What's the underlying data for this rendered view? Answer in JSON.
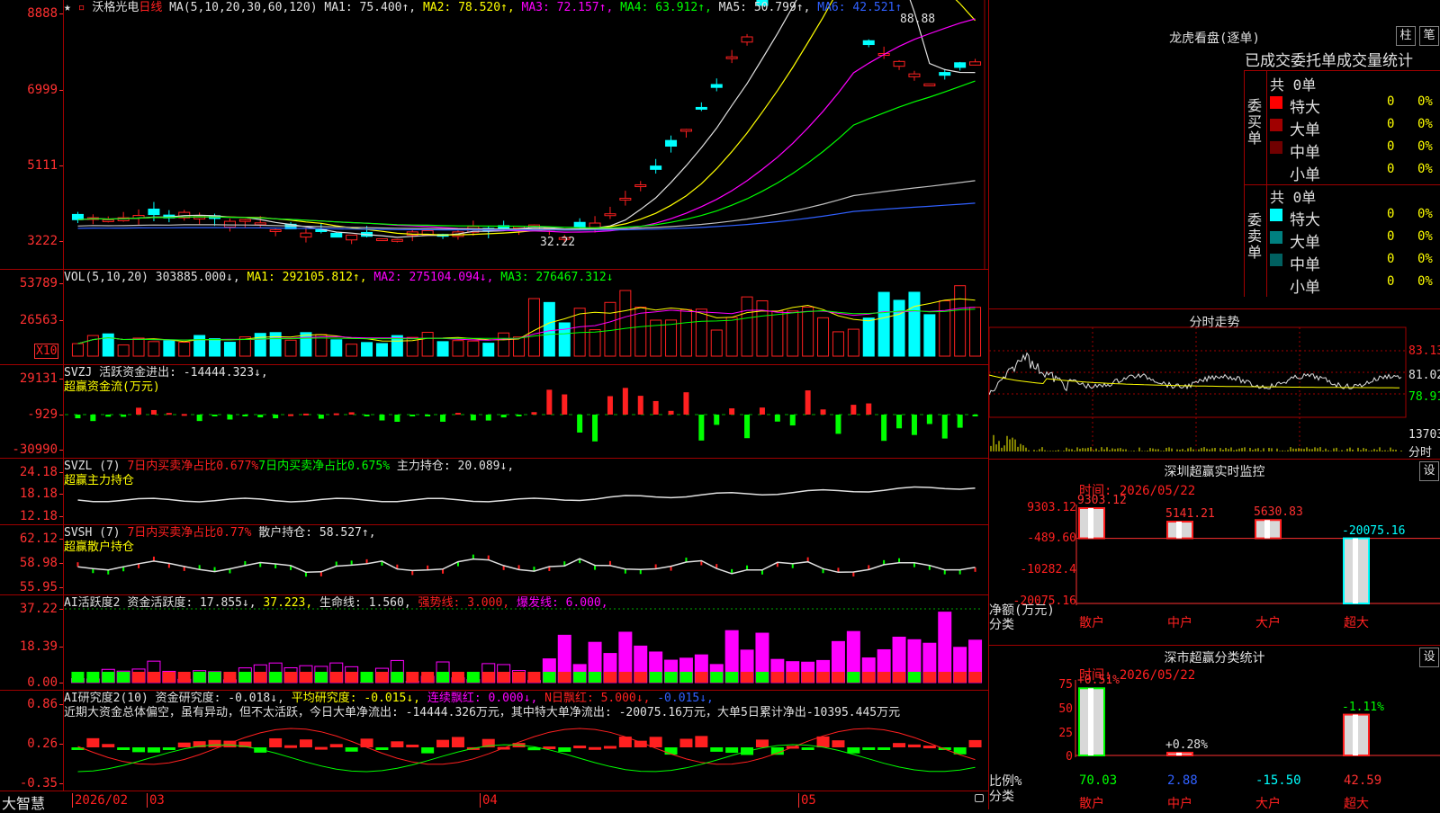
{
  "main": {
    "stock_name": "沃格光电",
    "period": "日线",
    "ma_params": "MA(5,10,20,30,60,120)",
    "ma_values": [
      {
        "label": "MA1: 75.400↑,",
        "color": "#e0e0e0"
      },
      {
        "label": "MA2: 78.520↑,",
        "color": "#ffff00"
      },
      {
        "label": "MA3: 72.157↑,",
        "color": "#ff00ff"
      },
      {
        "label": "MA4: 63.912↑,",
        "color": "#00ff00"
      },
      {
        "label": "MA5: 50.799↑,",
        "color": "#e0e0e0"
      },
      {
        "label": "MA6: 42.521↑",
        "color": "#3060ff"
      }
    ],
    "y_labels": [
      "8888",
      "6999",
      "5111",
      "3222"
    ],
    "high_marker": "88.88",
    "low_marker": "32.22"
  },
  "vol": {
    "header": "VOL(5,10,20)",
    "value": "303885.000↓,",
    "ma1": "MA1: 292105.812↑,",
    "ma2": "MA2: 275104.094↓,",
    "ma3": "MA3: 276467.312↓",
    "y_labels": [
      "53789",
      "26563"
    ],
    "unit_label": "X10"
  },
  "svzj": {
    "header": "SVZJ  活跃资金进出: -14444.323↓,",
    "subtitle": "超赢资金流(万元)",
    "y_labels": [
      "29131",
      "-929",
      "-30990"
    ]
  },
  "svzl": {
    "prefix": "SVZL (7)",
    "t1": "7日内买卖净占比0.677%",
    "t2": "7日内买卖净占比0.675%",
    "t3": "主力持仓: 20.089↓,",
    "subtitle": "超赢主力持仓",
    "y_labels": [
      "24.18",
      "18.18",
      "12.18"
    ]
  },
  "svsh": {
    "prefix": "SVSH (7)",
    "t1": "7日内买卖净占比0.77%",
    "t2": "散户持仓: 58.527↑,",
    "subtitle": "超赢散户持仓",
    "y_labels": [
      "62.12",
      "58.98",
      "55.95"
    ]
  },
  "ai1": {
    "prefix": "AI活跃度2",
    "t1": "资金活跃度: 17.855↓,",
    "t2": "37.223,",
    "t3": "生命线: 1.560,",
    "t4": "强势线: 3.000,",
    "t5": "爆发线: 6.000,",
    "y_labels": [
      "37.22",
      "18.39",
      "0.00"
    ]
  },
  "ai2": {
    "prefix": "AI研究度2(10)",
    "t1": "资金研究度: -0.018↓,",
    "t2": "平均研究度: -0.015↓,",
    "t3": "连续飘红: 0.000↓,",
    "t4": "N日飘红: 5.000↓,",
    "t5": "-0.015↓,",
    "comment": "近期大资金总体偏空，虽有异动，但不太活跃，今日大单净流出: -14444.326万元，其中特大单净流出: -20075.16万元，大单5日累计净出-10395.445万元",
    "y_labels": [
      "0.86",
      "0.26",
      "-0.35"
    ]
  },
  "xaxis": {
    "brand": "大智慧",
    "labels": [
      "2026/02",
      "03",
      "04",
      "05"
    ]
  },
  "dragon": {
    "title": "龙虎看盘(逐单)",
    "btn1": "柱",
    "btn2": "笔",
    "subtitle": "已成交委托单成交量统计",
    "buy_label": "委买单",
    "sell_label": "委卖单",
    "buy_total": "共 0单",
    "sell_total": "共 0单",
    "buy_rows": [
      {
        "name": "特大",
        "count": "0",
        "pct": "0%",
        "color": "#ff0000"
      },
      {
        "name": "大单",
        "count": "0",
        "pct": "0%",
        "color": "#a00000"
      },
      {
        "name": "中单",
        "count": "0",
        "pct": "0%",
        "color": "#700000"
      },
      {
        "name": "小单",
        "count": "0",
        "pct": "0%",
        "color": "#000000"
      }
    ],
    "sell_rows": [
      {
        "name": "特大",
        "count": "0",
        "pct": "0%",
        "color": "#00ffff"
      },
      {
        "name": "大单",
        "count": "0",
        "pct": "0%",
        "color": "#008080"
      },
      {
        "name": "中单",
        "count": "0",
        "pct": "0%",
        "color": "#006060"
      },
      {
        "name": "小单",
        "count": "0",
        "pct": "0%",
        "color": "#000000"
      }
    ]
  },
  "intraday": {
    "title": "分时走势",
    "y_labels": [
      "83.13",
      "81.02",
      "78.91"
    ],
    "vol_label": "13703",
    "tag": "分时"
  },
  "monitor": {
    "title": "深圳超赢实时监控",
    "btn": "设",
    "time": "时间: 2026/05/22",
    "y_labels": [
      "9303.12",
      "-489.60",
      "-10282.4",
      "-20075.16"
    ],
    "axis_label1": "净额(万元)",
    "axis_label2": "分类",
    "categories": [
      "散户",
      "中户",
      "大户",
      "超大"
    ],
    "bar_labels": [
      "9303.12",
      "5141.21",
      "5630.83",
      "-20075.16"
    ]
  },
  "classify": {
    "title": "深市超赢分类统计",
    "btn": "设",
    "time": "时间: 2026/05/22",
    "y_labels": [
      "75",
      "50",
      "25",
      "0"
    ],
    "axis_label1": "比例%",
    "axis_label2": "分类",
    "categories": [
      "散户",
      "中户",
      "大户",
      "超大"
    ],
    "bar_labels": [
      "+0.51%",
      "+0.28%",
      "",
      "-1.11%"
    ],
    "bottom_values": [
      "70.03",
      "2.88",
      "-15.50",
      "42.59"
    ]
  },
  "chart_data": [
    {
      "type": "bar",
      "title": "深圳超赢实时监控",
      "categories": [
        "散户",
        "中户",
        "大户",
        "超大"
      ],
      "values": [
        9303.12,
        5141.21,
        5630.83,
        -20075.16
      ],
      "ylabel": "净额(万元)",
      "ylim": [
        -20075.16,
        9303.12
      ]
    },
    {
      "type": "bar",
      "title": "深市超赢分类统计",
      "categories": [
        "散户",
        "中户",
        "大户",
        "超大"
      ],
      "values": [
        70.03,
        2.88,
        -15.5,
        42.59
      ],
      "ylabel": "比例%",
      "ylim": [
        0,
        75
      ]
    }
  ]
}
